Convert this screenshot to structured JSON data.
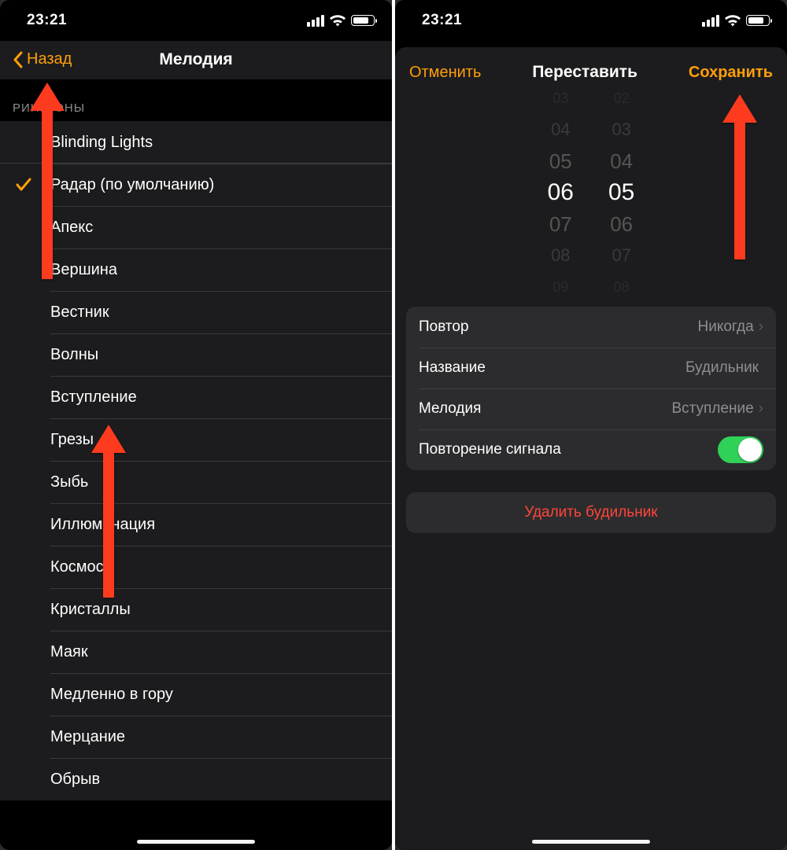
{
  "status": {
    "time": "23:21"
  },
  "left": {
    "back": "Назад",
    "title": "Мелодия",
    "section": "РИНГТОНЫ",
    "items": [
      {
        "label": "Blinding Lights",
        "checked": false
      },
      {
        "label": "Радар (по умолчанию)",
        "checked": true
      },
      {
        "label": "Апекс",
        "checked": false
      },
      {
        "label": "Вершина",
        "checked": false
      },
      {
        "label": "Вестник",
        "checked": false
      },
      {
        "label": "Волны",
        "checked": false
      },
      {
        "label": "Вступление",
        "checked": false
      },
      {
        "label": "Грезы",
        "checked": false
      },
      {
        "label": "Зыбь",
        "checked": false
      },
      {
        "label": "Иллюминация",
        "checked": false
      },
      {
        "label": "Космос",
        "checked": false
      },
      {
        "label": "Кристаллы",
        "checked": false
      },
      {
        "label": "Маяк",
        "checked": false
      },
      {
        "label": "Медленно в гору",
        "checked": false
      },
      {
        "label": "Мерцание",
        "checked": false
      },
      {
        "label": "Обрыв",
        "checked": false
      }
    ]
  },
  "right": {
    "cancel": "Отменить",
    "title": "Переставить",
    "save": "Сохранить",
    "picker": {
      "hours": [
        "03",
        "04",
        "05",
        "06",
        "07",
        "08",
        "09"
      ],
      "minutes": [
        "02",
        "03",
        "04",
        "05",
        "06",
        "07",
        "08"
      ],
      "selected_hour": "06",
      "selected_minute": "05"
    },
    "rows": {
      "repeat_label": "Повтор",
      "repeat_value": "Никогда",
      "name_label": "Название",
      "name_value": "Будильник",
      "sound_label": "Мелодия",
      "sound_value": "Вступление",
      "snooze_label": "Повторение сигнала",
      "snooze_on": true
    },
    "delete": "Удалить будильник"
  }
}
